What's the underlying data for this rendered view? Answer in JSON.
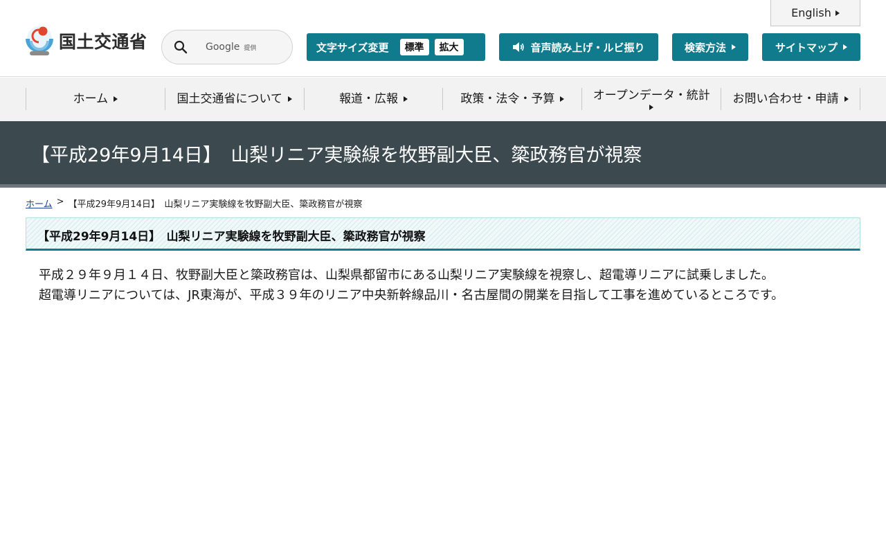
{
  "header": {
    "english_label": "English",
    "logo_text": "国土交通省",
    "search": {
      "brand": "Google",
      "brand_suffix": "提供"
    },
    "fontsize": {
      "label": "文字サイズ変更",
      "standard": "標準",
      "large": "拡大"
    },
    "voice_label": "音声読み上げ・ルビ振り",
    "howto_label": "検索方法",
    "sitemap_label": "サイトマップ"
  },
  "nav": {
    "items": [
      {
        "label": "ホーム"
      },
      {
        "label": "国土交通省について"
      },
      {
        "label": "報道・広報"
      },
      {
        "label": "政策・法令・予算"
      },
      {
        "label": "オープンデータ・統計"
      },
      {
        "label": "お問い合わせ・申請"
      }
    ]
  },
  "page": {
    "title": "【平成29年9月14日】　山梨リニア実験線を牧野副大臣、簗政務官が視察"
  },
  "breadcrumb": {
    "home": "ホーム",
    "separator": ">",
    "current": "【平成29年9月14日】　山梨リニア実験線を牧野副大臣、簗政務官が視察"
  },
  "article": {
    "heading": "【平成29年9月14日】　山梨リニア実験線を牧野副大臣、簗政務官が視察",
    "paragraphs": [
      "平成２９年９月１４日、牧野副大臣と簗政務官は、山梨県都留市にある山梨リニア実験線を視察し、超電導リニアに試乗しました。",
      "超電導リニアについては、JR東海が、平成３９年のリニア中央新幹線品川・名古屋間の開業を目指して工事を進めているところです。"
    ]
  },
  "colors": {
    "accent_teal": "#0f7b8c",
    "title_band": "#3c4a50",
    "nav_bg": "#f2f2f2"
  },
  "icons": {
    "search": "search-icon",
    "speaker": "speaker-icon",
    "arrow": "triangle-right-icon"
  }
}
